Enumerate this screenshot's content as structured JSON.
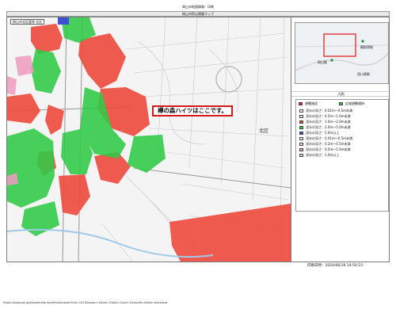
{
  "page_header": "岡山市地図情報：印刷",
  "map_title": "岡山市防災情報マップ",
  "area_tag": "岡山市北区富原 北区",
  "callout": "欅の森ハイツはここです。",
  "ward_label": "北区",
  "overview": {
    "station_label": "岡山駅",
    "east_label": "備前原駅",
    "sw_label": "西川原駅"
  },
  "legend": {
    "title": "凡例",
    "header_left": "避難施設",
    "header_right": "広域避難場所",
    "items": [
      {
        "label": "浸水の深さ：0.01m～0.5m未満",
        "color": "#ffffff"
      },
      {
        "label": "浸水の深さ：0.5m～1.0m未満",
        "color": "#ffe3ea"
      },
      {
        "label": "浸水の深さ：1.0m～2.0m未満",
        "color": "#ee4a3c"
      },
      {
        "label": "浸水の深さ：2.0m～5.0m未満",
        "color": "#2fcb46"
      },
      {
        "label": "浸水の深さ：5.0m以上",
        "color": "#3e4fd6"
      },
      {
        "label": "浸水の深さ：0.01m～0.5m未満",
        "color": "#f0f0f0"
      },
      {
        "label": "浸水の深さ：0.2m～0.5m未満",
        "color": "#fbd3dc"
      },
      {
        "label": "浸水の深さ：0.5m～1.0m未満",
        "color": "#f19bc0"
      },
      {
        "label": "浸水の深さ：1.0m以上",
        "color": "#f4c6e2"
      }
    ]
  },
  "print_time": "印刷日時：2020/06/16 14:50:15",
  "footer_url": "https://www.gis.jp/okayama/print/preview.aspx?mid=1015&zoom=4&mk=2&sfx=1&kz=1&mode=4&kw=okayama"
}
